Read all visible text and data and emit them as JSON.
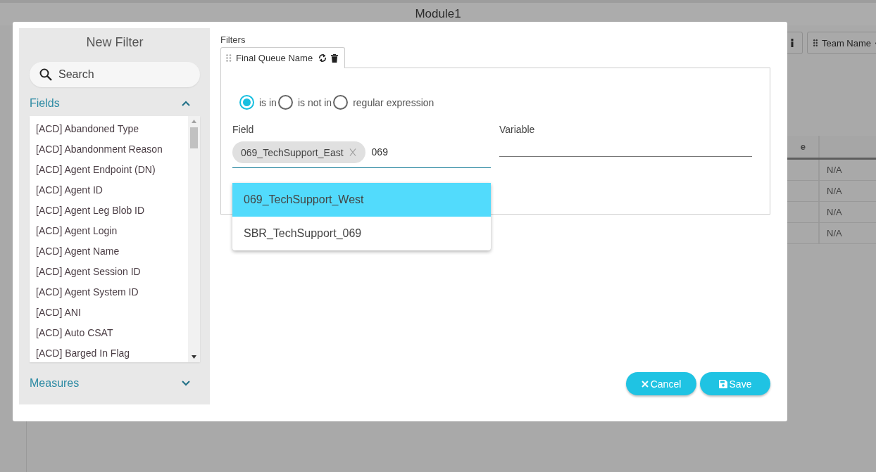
{
  "app": {
    "title": "Module1",
    "toolbar_chips": [
      {
        "label": "Team Name"
      }
    ],
    "table": {
      "column_1": "e",
      "rows": [
        "N/A",
        "N/A",
        "N/A",
        "N/A"
      ]
    }
  },
  "dialog": {
    "title": "New Filter",
    "search": {
      "placeholder": "Search"
    },
    "sections": [
      {
        "label": "Fields",
        "expanded": true,
        "items": [
          "[ACD] Abandoned Type",
          "[ACD] Abandonment Reason",
          "[ACD] Agent Endpoint (DN)",
          "[ACD] Agent ID",
          "[ACD] Agent Leg Blob ID",
          "[ACD] Agent Login",
          "[ACD] Agent Name",
          "[ACD] Agent Session ID",
          "[ACD] Agent System ID",
          "[ACD] ANI",
          "[ACD] Auto CSAT",
          "[ACD] Barged In Flag"
        ]
      },
      {
        "label": "Measures",
        "expanded": false
      }
    ],
    "filters_label": "Filters",
    "tabs": [
      {
        "label": "Final Queue Name",
        "selected": true
      }
    ],
    "operators": [
      {
        "label": "is in",
        "selected": true
      },
      {
        "label": "is not in",
        "selected": false
      },
      {
        "label": "regular expression",
        "selected": false
      }
    ],
    "field": {
      "label": "Field",
      "chips": [
        "069_TechSupport_East"
      ],
      "value": "069"
    },
    "suggestions": [
      {
        "label": "069_TechSupport_West",
        "highlighted": true
      },
      {
        "label": "SBR_TechSupport_069",
        "highlighted": false
      }
    ],
    "variable": {
      "label": "Variable"
    },
    "buttons": [
      {
        "label": "Cancel",
        "kind": "cancel"
      },
      {
        "label": "Save",
        "kind": "save"
      }
    ]
  }
}
